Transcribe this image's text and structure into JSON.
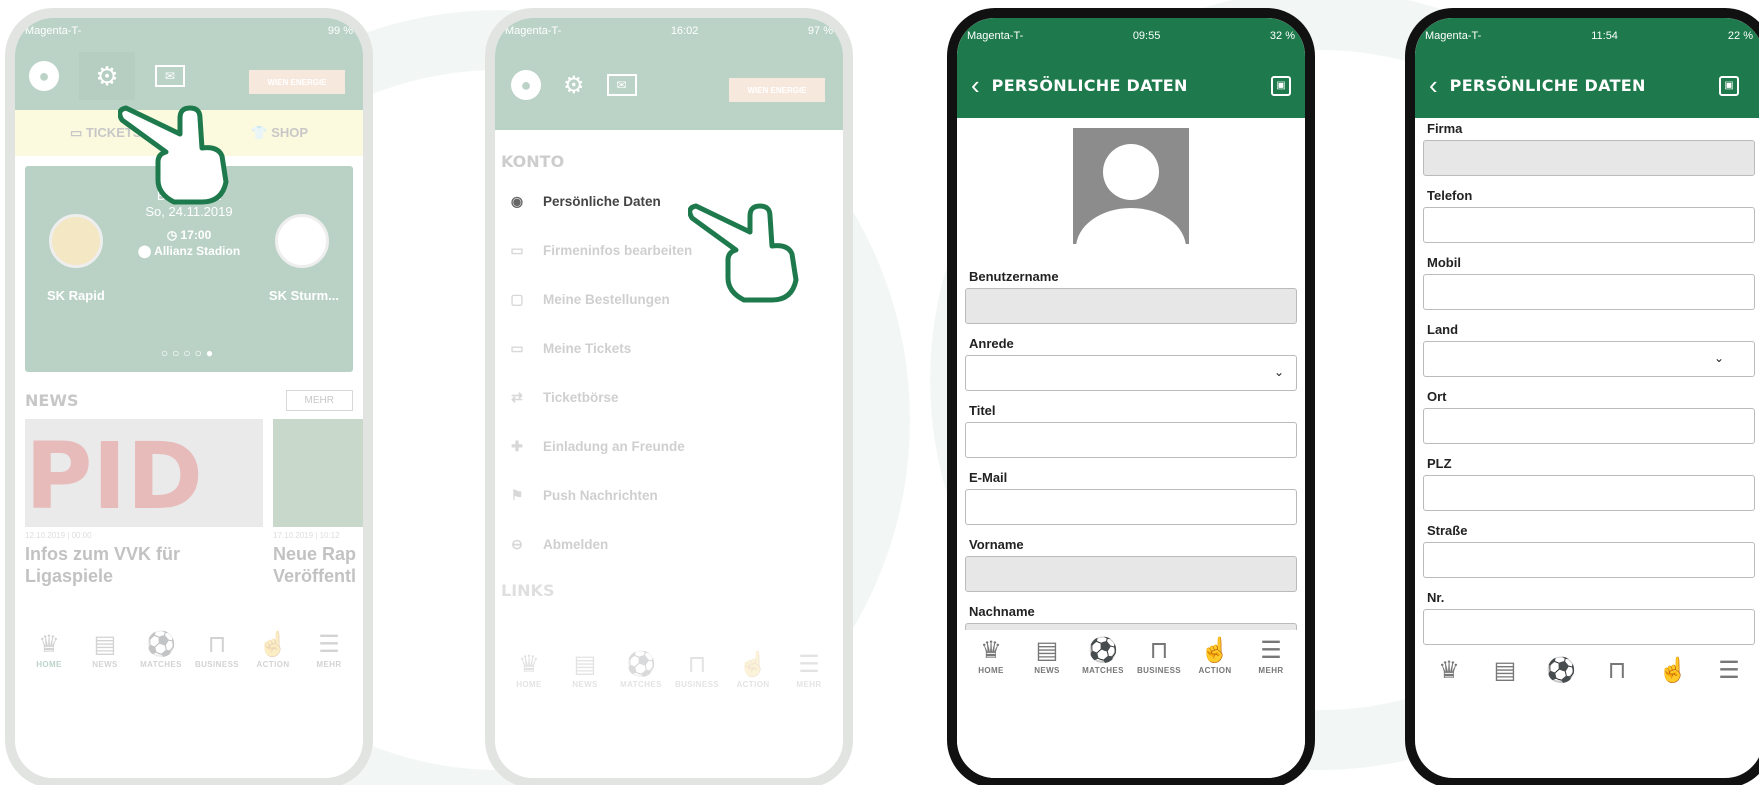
{
  "phone1": {
    "status": {
      "carrier": "Magenta-T-",
      "battery": "99 %"
    },
    "tabs": {
      "tickets": "TICKETS",
      "shop": "SHOP"
    },
    "match": {
      "league": "Bundesliga",
      "date": "So, 24.11.2019",
      "time": "17:00",
      "venue": "Allianz Stadion",
      "home": "SK Rapid",
      "away": "SK Sturm..."
    },
    "news": {
      "label": "NEWS",
      "more": "MEHR",
      "item1": {
        "date": "12.10.2019 | 00:00",
        "title": "Infos zum VVK für Ligaspiele"
      },
      "item2": {
        "date": "17.10.2019 | 10:12",
        "title": "Neue Rap Veröffentl"
      }
    },
    "sponsor": "WIEN ENERGIE"
  },
  "phone2": {
    "status": {
      "carrier": "Magenta-T-",
      "time": "16:02",
      "battery": "97 %"
    },
    "section_konto": "KONTO",
    "menu": [
      {
        "label": "Persönliche Daten",
        "icon": "user-circle-icon"
      },
      {
        "label": "Firmeninfos bearbeiten",
        "icon": "id-card-icon"
      },
      {
        "label": "Meine Bestellungen",
        "icon": "bag-icon"
      },
      {
        "label": "Meine Tickets",
        "icon": "ticket-icon"
      },
      {
        "label": "Ticketbörse",
        "icon": "exchange-icon"
      },
      {
        "label": "Einladung an Freunde",
        "icon": "gift-icon"
      },
      {
        "label": "Push Nachrichten",
        "icon": "flag-icon"
      },
      {
        "label": "Abmelden",
        "icon": "logout-icon"
      }
    ],
    "section_links": "LINKS",
    "sponsor": "WIEN ENERGIE"
  },
  "phone3": {
    "status": {
      "carrier": "Magenta-T-",
      "time": "09:55",
      "battery": "32 %"
    },
    "title": "PERSÖNLICHE DATEN",
    "fields": {
      "benutzername": "Benutzername",
      "anrede": "Anrede",
      "titel": "Titel",
      "email": "E-Mail",
      "vorname": "Vorname",
      "nachname": "Nachname"
    }
  },
  "phone4": {
    "status": {
      "carrier": "Magenta-T-",
      "time": "11:54",
      "battery": "22 %"
    },
    "title": "PERSÖNLICHE DATEN",
    "fields": {
      "firma": "Firma",
      "telefon": "Telefon",
      "mobil": "Mobil",
      "land": "Land",
      "ort": "Ort",
      "plz": "PLZ",
      "strasse": "Straße",
      "nr": "Nr."
    }
  },
  "tabbar": [
    "HOME",
    "NEWS",
    "MATCHES",
    "BUSINESS",
    "ACTION",
    "MEHR"
  ],
  "colors": {
    "brand_green": "#1e7a4c",
    "tab_yellow": "#f6ee86",
    "rapid_red": "#d62828"
  }
}
